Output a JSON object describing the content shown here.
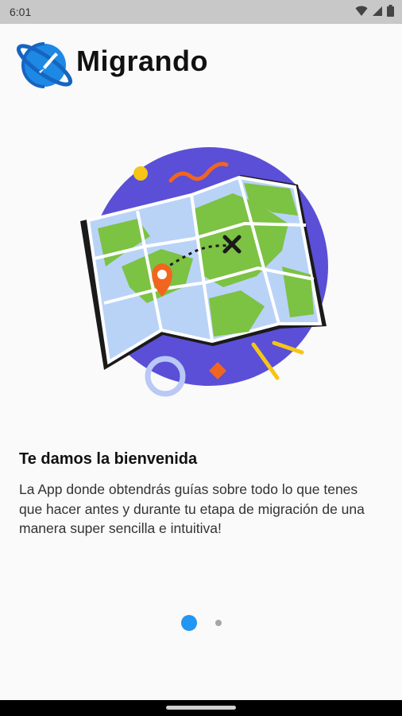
{
  "status_bar": {
    "time": "6:01",
    "icons": [
      "wifi-icon",
      "signal-icon",
      "battery-icon"
    ]
  },
  "app": {
    "name": "Migrando",
    "logo_icon": "planet-logo-icon",
    "colors": {
      "accent": "#2196f3",
      "logo_blue": "#1e88e5",
      "map_circle": "#5a4fd6",
      "map_land": "#7cc243",
      "map_water": "#b9d3f7",
      "pin": "#f2651f",
      "confetti_yellow": "#f5c518"
    }
  },
  "onboarding": {
    "illustration": "world-map-icon",
    "title": "Te damos la bienvenida",
    "description": "La App donde obtendrás guías sobre todo lo que tenes que hacer antes y durante tu etapa de migración de una manera super sencilla e intuitiva!",
    "pages": 2,
    "current_page": 1
  }
}
